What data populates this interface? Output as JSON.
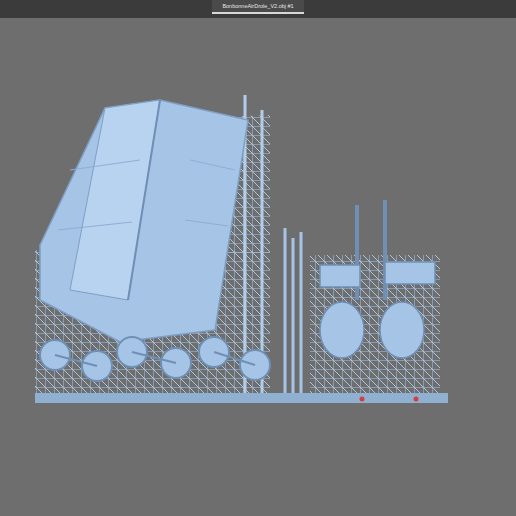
{
  "window": {
    "title": "BonbonneAirDrole_V2.obj #1"
  }
}
